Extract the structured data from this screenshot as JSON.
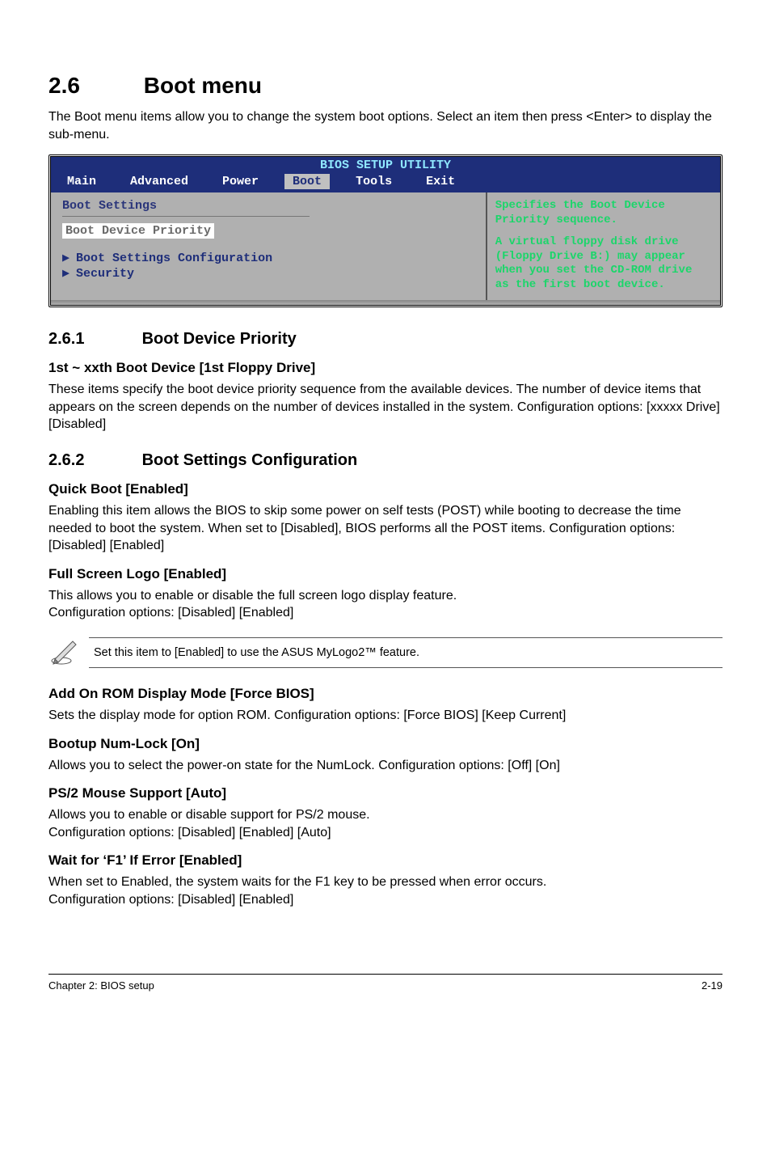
{
  "header": {
    "section_number": "2.6",
    "section_title": "Boot menu",
    "intro": "The Boot menu items allow you to change the system boot options. Select an item then press <Enter> to display the sub-menu."
  },
  "bios": {
    "utility_title": "BIOS SETUP UTILITY",
    "tabs": [
      "Main",
      "Advanced",
      "Power",
      "Boot",
      "Tools",
      "Exit"
    ],
    "left": {
      "heading": "Boot Settings",
      "highlighted": "Boot Device Priority",
      "items": [
        "Boot Settings Configuration",
        "Security"
      ]
    },
    "right": {
      "line1": "Specifies the Boot Device Priority sequence.",
      "line2": "A virtual floppy disk drive (Floppy Drive B:) may appear when you set the CD-ROM drive as the first boot device."
    }
  },
  "sub261": {
    "num": "2.6.1",
    "title": "Boot Device Priority",
    "s1_title": "1st ~ xxth Boot Device [1st Floppy Drive]",
    "s1_body": "These items specify the boot device priority sequence from the available devices. The number of device items that appears on the screen depends on the number of devices installed in the system. Configuration options: [xxxxx Drive] [Disabled]"
  },
  "sub262": {
    "num": "2.6.2",
    "title": "Boot Settings Configuration",
    "quick_title": "Quick Boot [Enabled]",
    "quick_body": "Enabling this item allows the BIOS to skip some power on self tests (POST) while booting to decrease the time needed to boot the system. When set to [Disabled], BIOS performs all the POST items. Configuration options: [Disabled] [Enabled]",
    "logo_title": "Full Screen Logo [Enabled]",
    "logo_body1": "This allows you to enable or disable the full screen logo display feature.",
    "logo_body2": "Configuration options: [Disabled] [Enabled]",
    "note_text": "Set this item to [Enabled] to use the ASUS MyLogo2™ feature.",
    "rom_title": "Add On ROM Display Mode [Force BIOS]",
    "rom_body": "Sets the display mode for option ROM. Configuration options: [Force BIOS] [Keep Current]",
    "num_title": "Bootup Num-Lock [On]",
    "num_body": "Allows you to select the power-on state for the NumLock. Configuration options: [Off] [On]",
    "ps2_title": "PS/2 Mouse Support [Auto]",
    "ps2_body1": "Allows you to enable or disable support for PS/2 mouse.",
    "ps2_body2": "Configuration options: [Disabled] [Enabled] [Auto]",
    "f1_title": "Wait for ‘F1’ If Error [Enabled]",
    "f1_body1": "When set to Enabled, the system waits for the F1 key to be pressed when error occurs.",
    "f1_body2": "Configuration options: [Disabled] [Enabled]"
  },
  "footer": {
    "left": "Chapter 2: BIOS setup",
    "right": "2-19"
  }
}
